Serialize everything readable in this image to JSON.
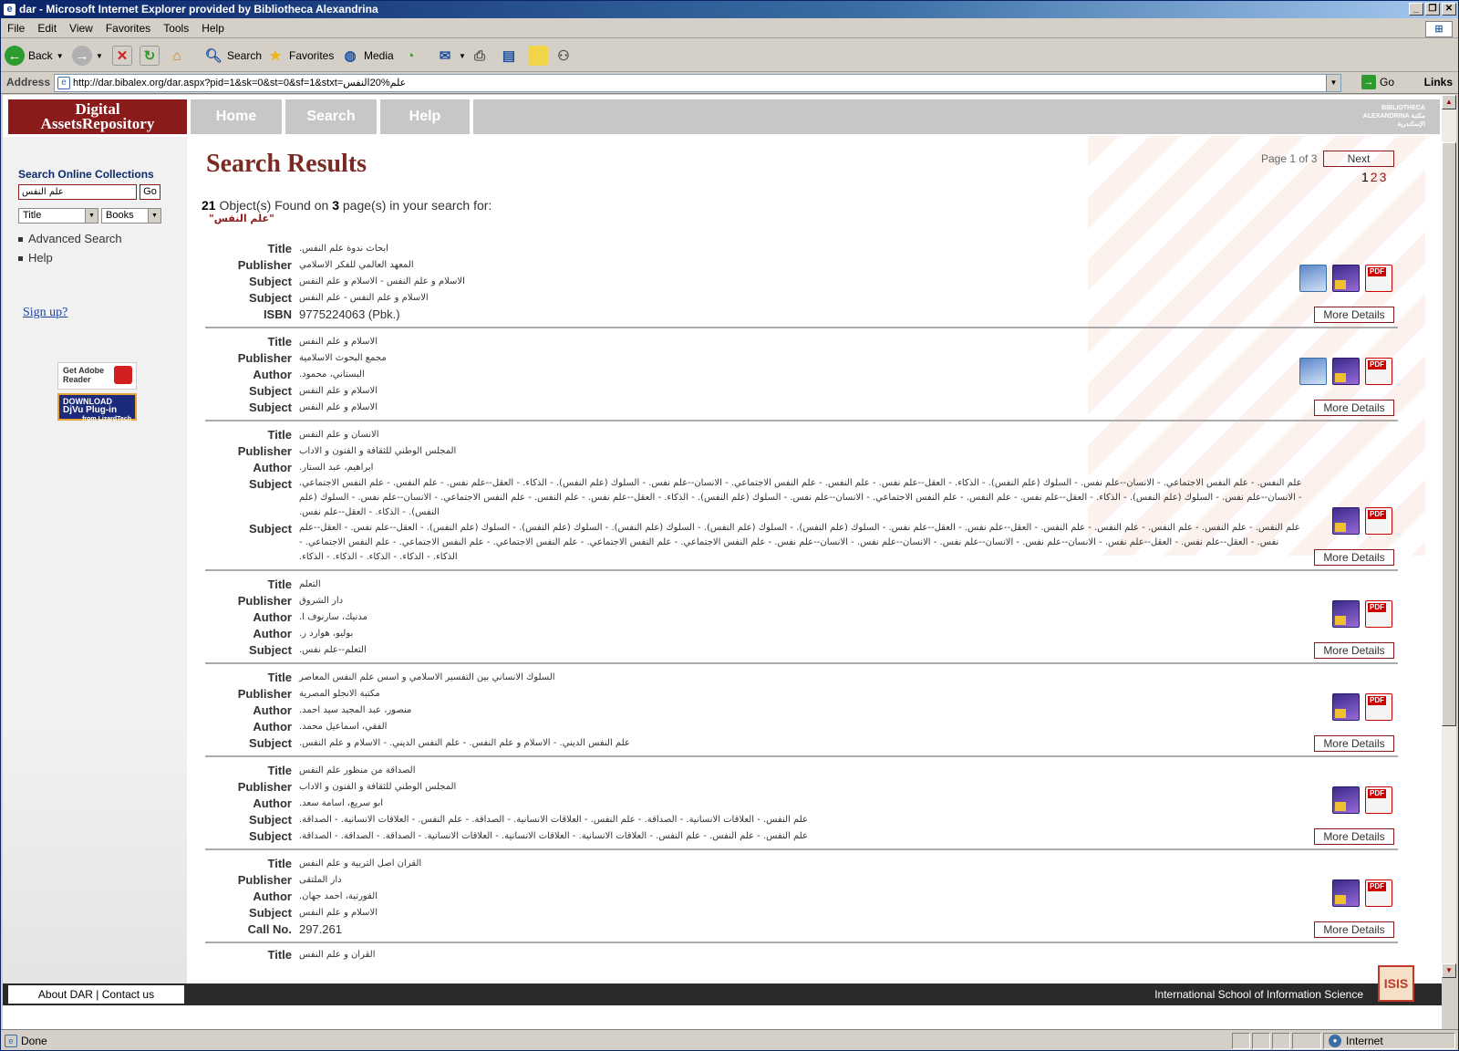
{
  "window": {
    "title": "dar - Microsoft Internet Explorer provided by Bibliotheca Alexandrina"
  },
  "menu": [
    "File",
    "Edit",
    "View",
    "Favorites",
    "Tools",
    "Help"
  ],
  "toolbar": {
    "back": "Back",
    "search": "Search",
    "favorites": "Favorites",
    "media": "Media"
  },
  "address": {
    "label": "Address",
    "url": "http://dar.bibalex.org/dar.aspx?pid=1&sk=0&st=0&sf=1&stxt=علم%20النفس",
    "go": "Go",
    "links": "Links"
  },
  "status": {
    "text": "Done",
    "zone": "Internet"
  },
  "site": {
    "logo_line1": "Digital",
    "logo_line2": "AssetsRepository",
    "nav": [
      "Home",
      "Search",
      "Help"
    ],
    "bibalex": "BIBLIOTHECA ALEXANDRINA مكتبة الإسكندرية"
  },
  "sidebar": {
    "title": "Search Online Collections",
    "query": "علم النفس",
    "go": "Go",
    "field": "Title",
    "collection": "Books",
    "advanced": "Advanced Search",
    "help": "Help",
    "signup": "Sign up?",
    "adobe": "Get Adobe Reader",
    "djvu_top": "DOWNLOAD",
    "djvu": "DjVu Plug-in",
    "djvu_sub": "from LizardTech"
  },
  "results": {
    "heading": "Search Results",
    "page_info": "Page 1 of 3",
    "next": "Next",
    "pages": [
      "1",
      "2",
      "3"
    ],
    "count": "21",
    "found_text1": " Object(s) Found on ",
    "pagecount": "3",
    "found_text2": " page(s) in your search for:",
    "query": "\"علم النفس\"",
    "more": "More Details",
    "records": [
      {
        "rows": [
          [
            "Title",
            "ابحاث ندوة علم النفس."
          ],
          [
            "Publisher",
            "المعهد العالمي للفكر الاسلامي"
          ],
          [
            "Subject",
            "الاسلام و علم النفس - الاسلام و علم النفس"
          ],
          [
            "Subject",
            "الاسلام و علم النفس - علم النفس"
          ],
          [
            "ISBN",
            "9775224063 (Pbk.)"
          ]
        ],
        "icons": [
          "dl",
          "dj",
          "pdf"
        ]
      },
      {
        "rows": [
          [
            "Title",
            "الاسلام و علم النفس"
          ],
          [
            "Publisher",
            "مجمع البحوث الاسلامية"
          ],
          [
            "Author",
            "البستاني، محمود."
          ],
          [
            "Subject",
            "الاسلام و علم النفس"
          ],
          [
            "Subject",
            "الاسلام و علم النفس"
          ]
        ],
        "icons": [
          "dl",
          "dj",
          "pdf"
        ]
      },
      {
        "rows": [
          [
            "Title",
            "الانسان و علم النفس"
          ],
          [
            "Publisher",
            "المجلس الوطني للثقافة و الفنون و الاداب"
          ],
          [
            "Author",
            "ابراهيم، عبد الستار."
          ],
          [
            "Subject",
            "علم النفس. - علم النفس الاجتماعي. - الانسان--علم نفس. - السلوك (علم النفس). - الذكاء. - العقل--علم نفس. - علم النفس. - علم النفس الاجتماعي. - الانسان--علم نفس. - السلوك (علم النفس). - الذكاء. - العقل--علم نفس. - علم النفس. - علم النفس الاجتماعي. - الانسان--علم نفس. - السلوك (علم النفس). - الذكاء. - العقل--علم نفس. - علم النفس. - علم النفس الاجتماعي. - الانسان--علم نفس. - السلوك (علم النفس). - الذكاء. - العقل--علم نفس. - علم النفس. - علم النفس الاجتماعي. - الانسان--علم نفس. - السلوك (علم النفس). - الذكاء. - العقل--علم نفس."
          ],
          [
            "Subject",
            "علم النفس. - علم النفس. - علم النفس. - علم النفس. - علم النفس. - العقل--علم نفس. - العقل--علم نفس. - السلوك (علم النفس). - السلوك (علم النفس). - السلوك (علم النفس). - السلوك (علم النفس). - السلوك (علم النفس). - العقل--علم نفس. - العقل--علم نفس. - العقل--علم نفس. - العقل--علم نفس. - الانسان--علم نفس. - الانسان--علم نفس. - الانسان--علم نفس. - الانسان--علم نفس. - علم النفس الاجتماعي. - علم النفس الاجتماعي. - علم النفس الاجتماعي. - علم النفس الاجتماعي. - علم النفس الاجتماعي. - الذكاء. - الذكاء. - الذكاء. - الذكاء. - الذكاء."
          ]
        ],
        "icons": [
          "dj",
          "pdf"
        ],
        "multi": true
      },
      {
        "rows": [
          [
            "Title",
            "التعلم"
          ],
          [
            "Publisher",
            "دار الشروق"
          ],
          [
            "Author",
            "مدنيك، سارنوف ا."
          ],
          [
            "Author",
            "بوليو، هوارد ر."
          ],
          [
            "Subject",
            "التعلم--علم نفس."
          ]
        ],
        "icons": [
          "dj",
          "pdf"
        ]
      },
      {
        "rows": [
          [
            "Title",
            "السلوك الانساني بين التفسير الاسلامي و اسس علم النفس المعاصر"
          ],
          [
            "Publisher",
            "مكتبة الانجلو المصرية"
          ],
          [
            "Author",
            "منصور، عبد المجيد سيد احمد."
          ],
          [
            "Author",
            "الفقي، اسماعيل محمد."
          ],
          [
            "Subject",
            "علم النفس الديني. - الاسلام و علم النفس. - علم النفس الديني. - الاسلام و علم النفس."
          ]
        ],
        "icons": [
          "dj",
          "pdf"
        ]
      },
      {
        "rows": [
          [
            "Title",
            "الصداقة من منظور علم النفس"
          ],
          [
            "Publisher",
            "المجلس الوطني للثقافة و الفنون و الاداب"
          ],
          [
            "Author",
            "ابو سريع، اسامة سعد."
          ],
          [
            "Subject",
            "علم النفس. - العلاقات الانسانية. - الصداقة. - علم النفس. - العلاقات الانسانية. - الصداقة. - علم النفس. - العلاقات الانسانية. - الصداقة."
          ],
          [
            "Subject",
            "علم النفس. - علم النفس. - علم النفس. - العلاقات الانسانية. - العلاقات الانسانية. - العلاقات الانسانية. - الصداقة. - الصداقة. - الصداقة."
          ]
        ],
        "icons": [
          "dj",
          "pdf"
        ]
      },
      {
        "rows": [
          [
            "Title",
            "القران اصل التربية و علم النفس"
          ],
          [
            "Publisher",
            "دار الملتقى"
          ],
          [
            "Author",
            "الفورتية، احمد جهان."
          ],
          [
            "Subject",
            "الاسلام و علم النفس"
          ],
          [
            "Call No.",
            "297.261"
          ]
        ],
        "icons": [
          "dj",
          "pdf"
        ]
      }
    ],
    "partial_label": "Title",
    "partial_value": "القران و علم النفس"
  },
  "footer": {
    "about": "About DAR",
    "contact": "Contact us",
    "sep": " | ",
    "right": "International School of Information Science",
    "logo": "ISIS"
  }
}
